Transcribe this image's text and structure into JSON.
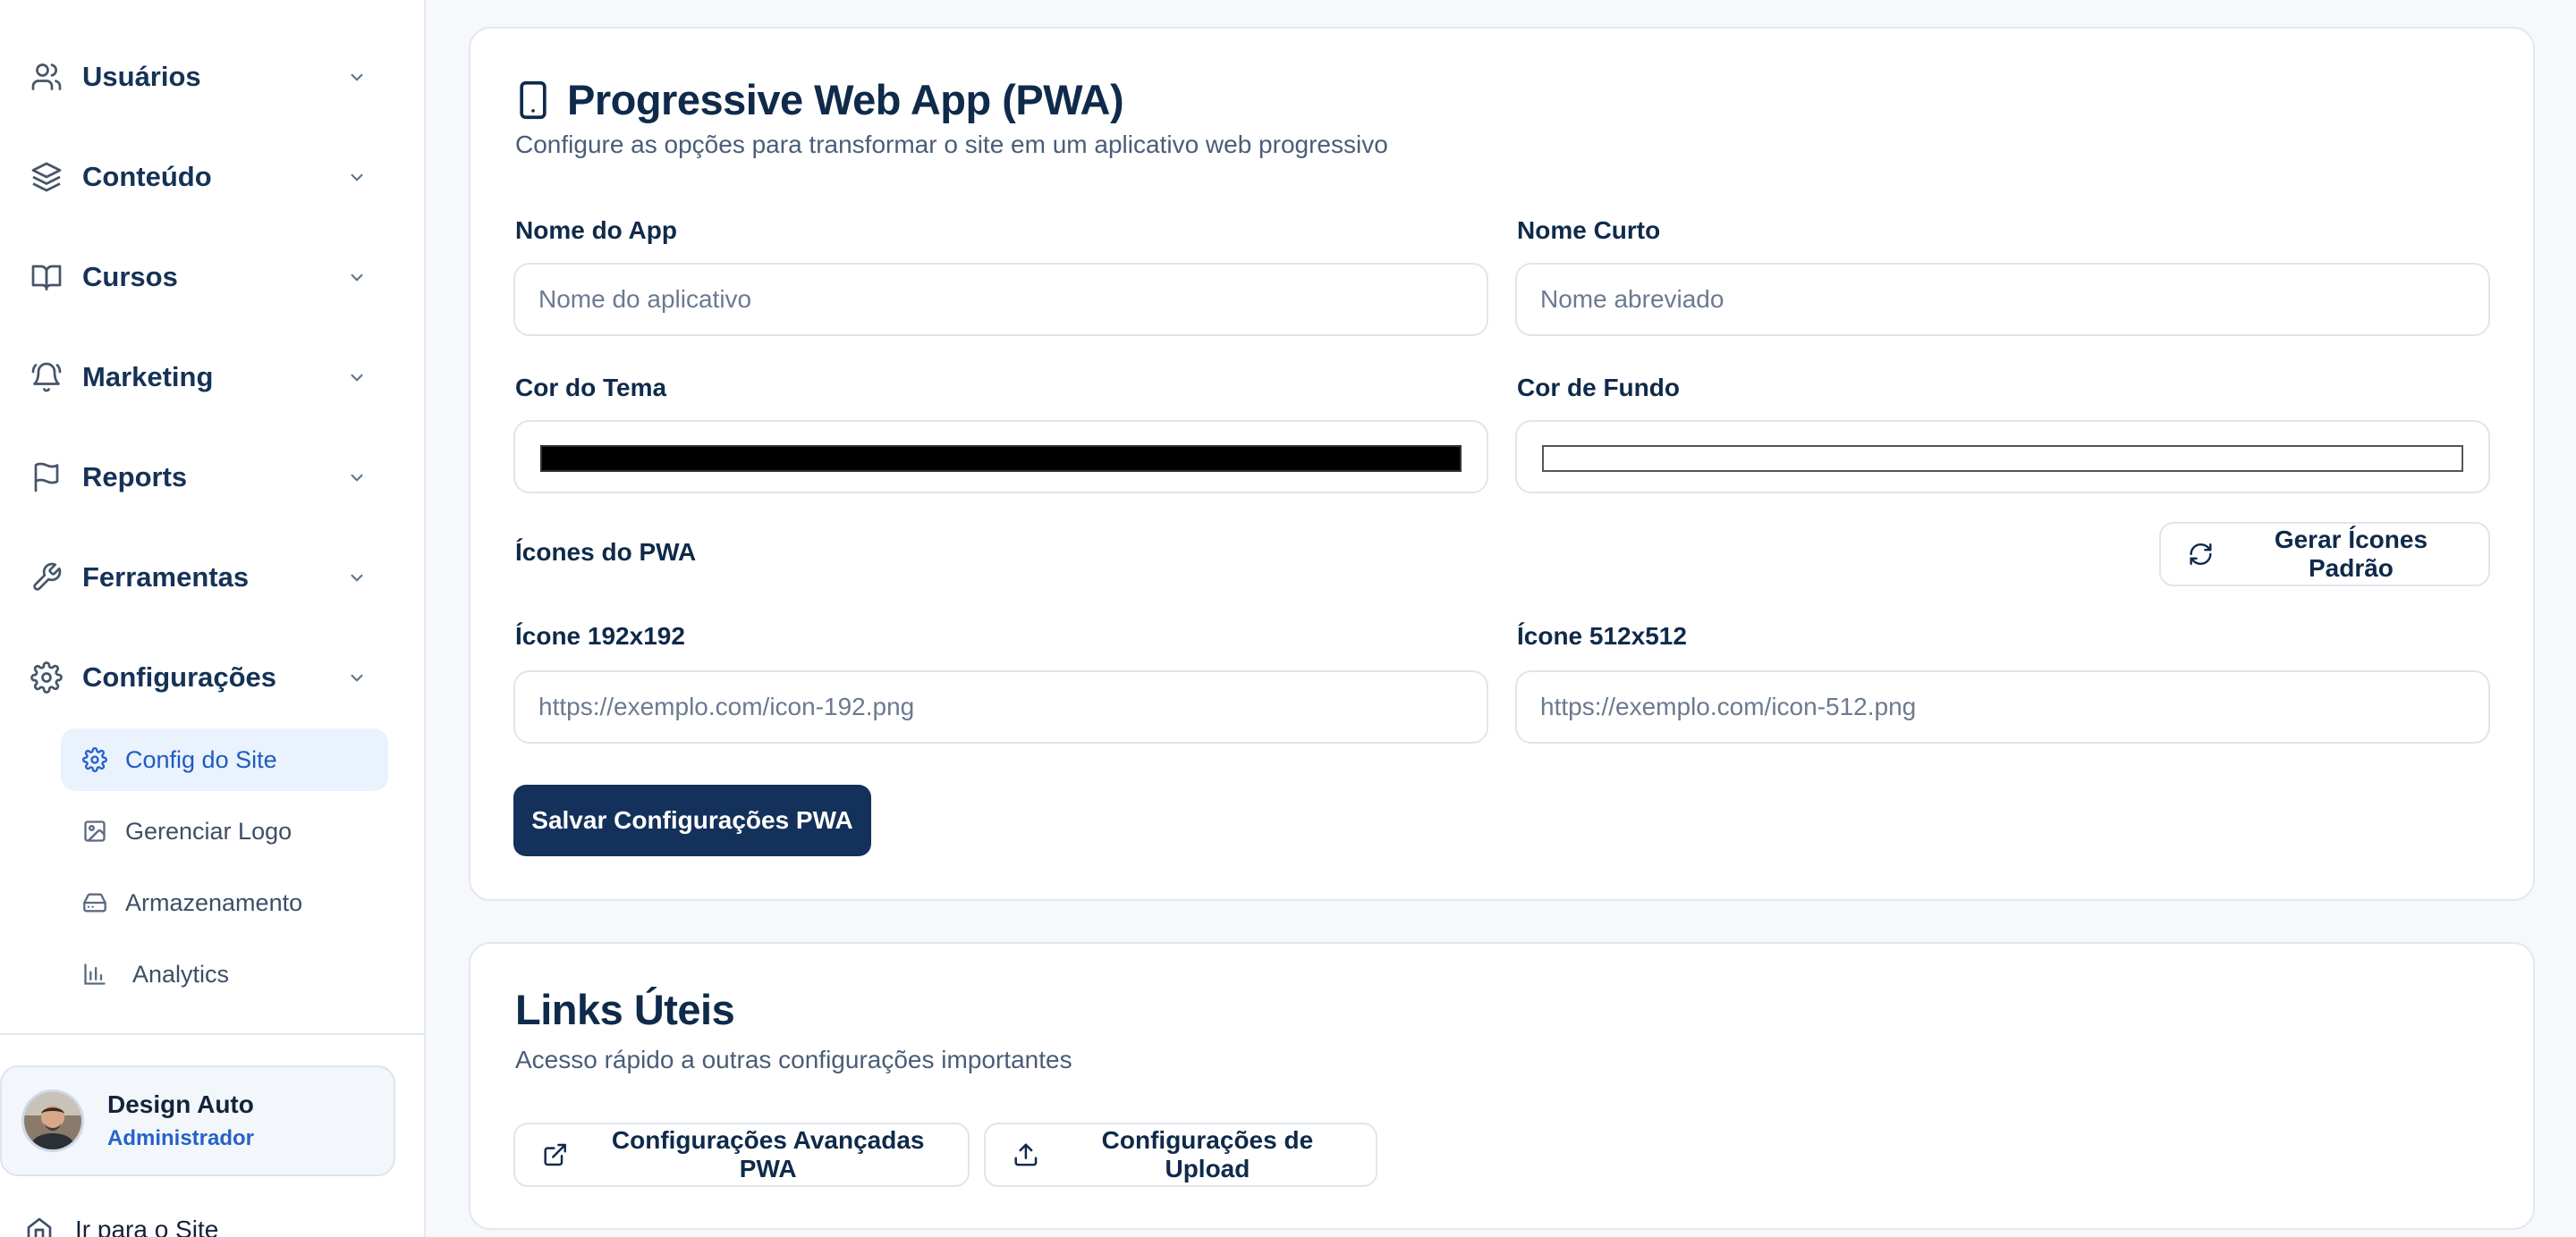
{
  "sidebar": {
    "groups": [
      {
        "label": "Usuários",
        "icon": "users-icon"
      },
      {
        "label": "Conteúdo",
        "icon": "layers-icon"
      },
      {
        "label": "Cursos",
        "icon": "book-open-icon"
      },
      {
        "label": "Marketing",
        "icon": "bell-icon"
      },
      {
        "label": "Reports",
        "icon": "flag-icon"
      },
      {
        "label": "Ferramentas",
        "icon": "wrench-icon"
      },
      {
        "label": "Configurações",
        "icon": "gear-icon"
      }
    ],
    "sub_items": [
      {
        "label": "Config do Site",
        "icon": "gear-icon",
        "active": true
      },
      {
        "label": "Gerenciar Logo",
        "icon": "image-icon",
        "active": false
      },
      {
        "label": "Armazenamento",
        "icon": "hard-drive-icon",
        "active": false
      },
      {
        "label": "Analytics",
        "icon": "bar-chart-icon",
        "active": false
      }
    ],
    "user": {
      "name": "Design Auto",
      "role": "Administrador"
    },
    "go_site_label": "Ir para o Site"
  },
  "pwa": {
    "title": "Progressive Web App (PWA)",
    "subtitle": "Configure as opções para transformar o site em um aplicativo web progressivo",
    "app_name": {
      "label": "Nome do App",
      "placeholder": "Nome do aplicativo",
      "value": ""
    },
    "short_name": {
      "label": "Nome Curto",
      "placeholder": "Nome abreviado",
      "value": ""
    },
    "theme_color": {
      "label": "Cor do Tema",
      "value": "#000000"
    },
    "background_color": {
      "label": "Cor de Fundo",
      "value": "#ffffff"
    },
    "icons_label": "Ícones do PWA",
    "generate_button": "Gerar Ícones Padrão",
    "icon_192": {
      "label": "Ícone 192x192",
      "placeholder": "https://exemplo.com/icon-192.png",
      "value": ""
    },
    "icon_512": {
      "label": "Ícone 512x512",
      "placeholder": "https://exemplo.com/icon-512.png",
      "value": ""
    },
    "save_button": "Salvar Configurações PWA"
  },
  "links": {
    "title": "Links Úteis",
    "subtitle": "Acesso rápido a outras configurações importantes",
    "advanced_button": "Configurações Avançadas PWA",
    "upload_button": "Configurações de Upload"
  },
  "colors": {
    "primary": "#13315a",
    "active_bg": "#eaf2fd",
    "active_text": "#1f5bbf",
    "border": "#dfe5ee"
  }
}
